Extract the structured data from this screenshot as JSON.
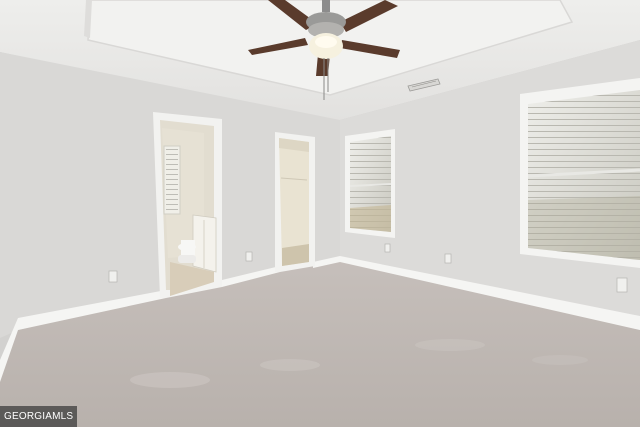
{
  "watermark": {
    "text": "GEORGIAMLS"
  },
  "scene": {
    "description_objects": [
      "room",
      "ceiling-fan",
      "bathroom-doorway",
      "closet-doorway",
      "window-left",
      "window-right",
      "carpet-floor",
      "baseboards",
      "tray-ceiling",
      "air-vent",
      "outlets"
    ],
    "colors": {
      "wall": "#d9d8d6",
      "wall_shadow": "#cbcac8",
      "ceiling": "#e6e5e3",
      "tray": "#eeeeec",
      "carpet": "#bdb6b1",
      "trim": "#f5f5f3",
      "fan_blade": "#5a3b2c",
      "fan_metal": "#8c8c8c",
      "fan_light": "#f6f1df",
      "window_glass": "#dcdcd4",
      "bath_tile": "#d9cfbe",
      "closet_wall": "#e7e0cf"
    }
  }
}
